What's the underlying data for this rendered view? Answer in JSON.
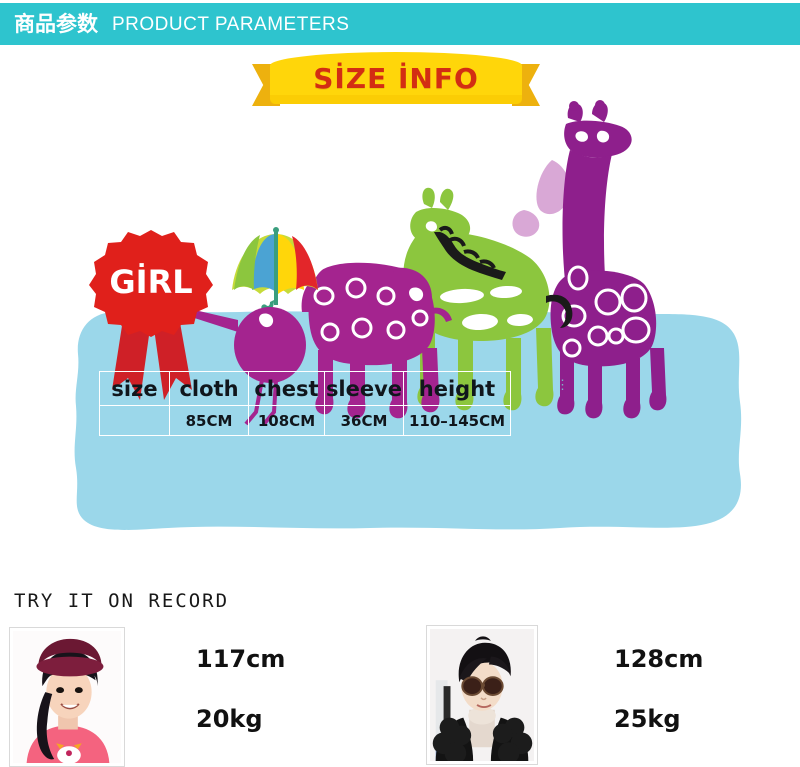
{
  "header": {
    "title_cn": "商品参数",
    "title_en": "PRODUCT PARAMETERS",
    "bg_color": "#2EC4CE",
    "text_color": "#FFFFFF"
  },
  "banner": {
    "label": "SİZE İNFO",
    "ribbon_color": "#FFD60A",
    "ribbon_tail_color": "#EDB10E",
    "text_color": "#D32D13"
  },
  "scene": {
    "badge_label": "GİRL",
    "badge_color": "#E0201B",
    "blob_color": "#9BD7EA",
    "icons": [
      "rosette-badge-icon",
      "bird-with-umbrella-icon",
      "elephant-icon",
      "green-horse-icon",
      "giraffe-icon",
      "rainbow-icon",
      "leaf-flourish-icon"
    ],
    "palette": {
      "purple": "#8E1F8C",
      "magenta": "#A4248F",
      "green": "#8CC63E",
      "light_purple": "#D9A8D6",
      "umbrella_colors": [
        "#8CC63E",
        "#C6DB3A",
        "#4BA3D3",
        "#FFD60A",
        "#F3901D",
        "#E3262A"
      ],
      "rainbow_colors": [
        "#8E1F8C",
        "#4BA3D3",
        "#8CC63E",
        "#FFD60A",
        "#F3901D",
        "#E3262A"
      ]
    }
  },
  "size_table": {
    "headers": [
      "size",
      "cloth",
      "chest",
      "sleeve",
      "height"
    ],
    "rows": [
      [
        "",
        "85CM",
        "108CM",
        "36CM",
        "110–145CM"
      ]
    ],
    "border_color": "#FFFFFF",
    "text_color": "#10161C",
    "trailing_dots": "⋮"
  },
  "try_on_record": {
    "label": "TRY IT ON RECORD",
    "entries": [
      {
        "photo_name": "girl-in-pink-top-photo",
        "height": "117cm",
        "weight": "20kg"
      },
      {
        "photo_name": "boy-in-fur-coat-photo",
        "height": "128cm",
        "weight": "25kg"
      }
    ]
  }
}
